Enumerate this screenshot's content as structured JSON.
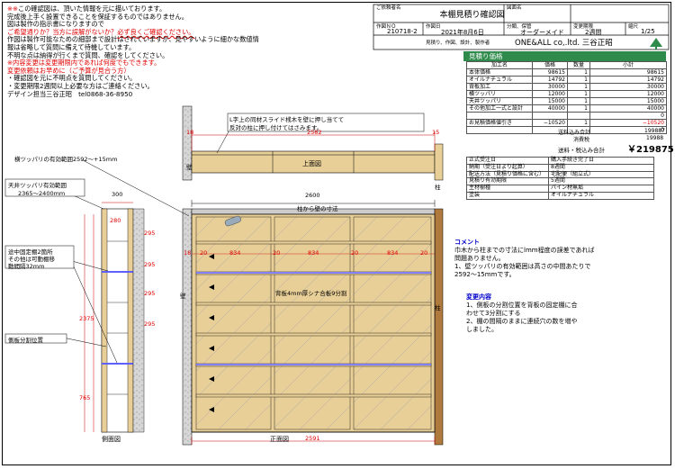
{
  "notes": {
    "title_marks": "※※",
    "line1": "この確認図は、頂いた情報を元に描いております。",
    "line2": "完成後上手く設置できることを保証するものではありません。",
    "line3": "図は製作の指示書になりますので",
    "line4_red": "ご希望通りか？当方に誤解がないか？",
    "line4_wave": "必ず良くご確認ください。",
    "line5": "作図は製作可能なための細部まで設計はされていますが、見やすいように細かな数値情",
    "line6": "報は省略して質問に備えて待機しています。",
    "line7": "不明な点は納得が行くまで質問、確認をしてください。",
    "line8_red": "※内容変更は変更期限内であれば何度でもできます。",
    "line9_red": "変更依頼はお早めに（ご予算が見合う方）",
    "line10": "・確認図を元に不明点を質問してください。",
    "line11": "・変更期限2週間以上必要な方はご連絡ください。",
    "line12": "デザイン担当三谷正昭　tel0868-36-8950"
  },
  "header": {
    "customer_caption": "ご依頼者名",
    "drawing_caption": "図面名",
    "drawing_name": "本棚見積り確認図",
    "ver_no_caption": "作図ＮＯ",
    "ver_no": "210718-2",
    "date_caption": "作図日",
    "date": "2021年8月6日",
    "category_caption": "分類、保管",
    "category": "オーダーメイド",
    "deadline_caption": "変更期限",
    "deadline": "2週間",
    "scale_caption": "縮尺",
    "scale": "1/25",
    "maker_caption": "見積り、作図、設計、製作者",
    "maker": "ONE&ALL co,.ltd.  三谷正昭"
  },
  "price": {
    "title": "見積り価格",
    "cols": [
      "加工名",
      "価格",
      "数量",
      "小計"
    ],
    "rows": [
      [
        "本体価格",
        "98615",
        "1",
        "98615"
      ],
      [
        "オイルナチュラル",
        "14792",
        "1",
        "14792"
      ],
      [
        "背板加工",
        "30000",
        "1",
        "30000"
      ],
      [
        "横ツッパリ",
        "12000",
        "1",
        "12000"
      ],
      [
        "天井ツッパリ",
        "15000",
        "1",
        "15000"
      ],
      [
        "その他加工一式と設計",
        "40000",
        "1",
        "40000"
      ],
      [
        "",
        "",
        "",
        "0"
      ],
      [
        "お見積価格値引き",
        "−10520",
        "1",
        "−10520"
      ]
    ],
    "zero_row": "0",
    "subtotal_label": "送料込み合計",
    "subtotal": "199887",
    "tax_label": "消費税",
    "tax": "19988",
    "total_label": "送料・税込み合計",
    "total": "￥219875"
  },
  "spec": [
    [
      "正式受注日",
      "購入手続き完了日"
    ],
    [
      "納期（受注日より起算）",
      "8週間"
    ],
    [
      "配送方法（見積り価格に含む）",
      "宅配便（組立式）"
    ],
    [
      "見積り有効期限",
      "5週間"
    ],
    [
      "主材樹種",
      "パイン材無垢"
    ],
    [
      "塗装",
      "オイルナチュラル"
    ]
  ],
  "drawing": {
    "top_view": "上面図",
    "front_view": "正面図",
    "side_view": "側面図",
    "wall": "壁",
    "pillar": "柱",
    "pillar_to_wall": "柱から壁の寸法",
    "callout_slide": "L字上の同材スライド桟木を壁に押し当てて",
    "callout_slide2": "反対の柱に押し付けてはさみます。",
    "side_brace": "横ツッパリの有効範囲2592〜+15mm",
    "ceiling_brace": "天井ツッパリ有効範囲",
    "ceiling_range": "2365〜2400mm",
    "fixed_shelf": "途中固定棚2箇所",
    "fixed_shelf2": "その他は可動棚移",
    "fixed_shelf3": "動間隔32mm",
    "side_split": "側板分割位置",
    "back_panel": "背板4mm厚シナ合板9分割",
    "dim_2582": "2582",
    "dim_2600": "2600",
    "dim_2591": "2591",
    "dim_18": "18",
    "dim_15": "15",
    "dim_20": "20",
    "dim_834": "834",
    "dim_300": "300",
    "dim_280": "280",
    "dim_2375": "2375",
    "dim_765": "765",
    "dim_295": "295"
  },
  "comment": {
    "title": "コメント",
    "l1": "巾木から柱までの寸法にlmm程度の誤差であれば",
    "l2": "問題ありません。",
    "l3": "1、壁ツッパリの有効範囲は高さの中間あたりで",
    "l4": "2592〜15mmです。"
  },
  "change": {
    "title": "変更内容",
    "l1": "1、側板の分割位置を背板の固定棚に合",
    "l2": "わせて3分割にする",
    "l3": "2、棚の間隔のままに連続穴の数を増や",
    "l4": "しました。"
  }
}
